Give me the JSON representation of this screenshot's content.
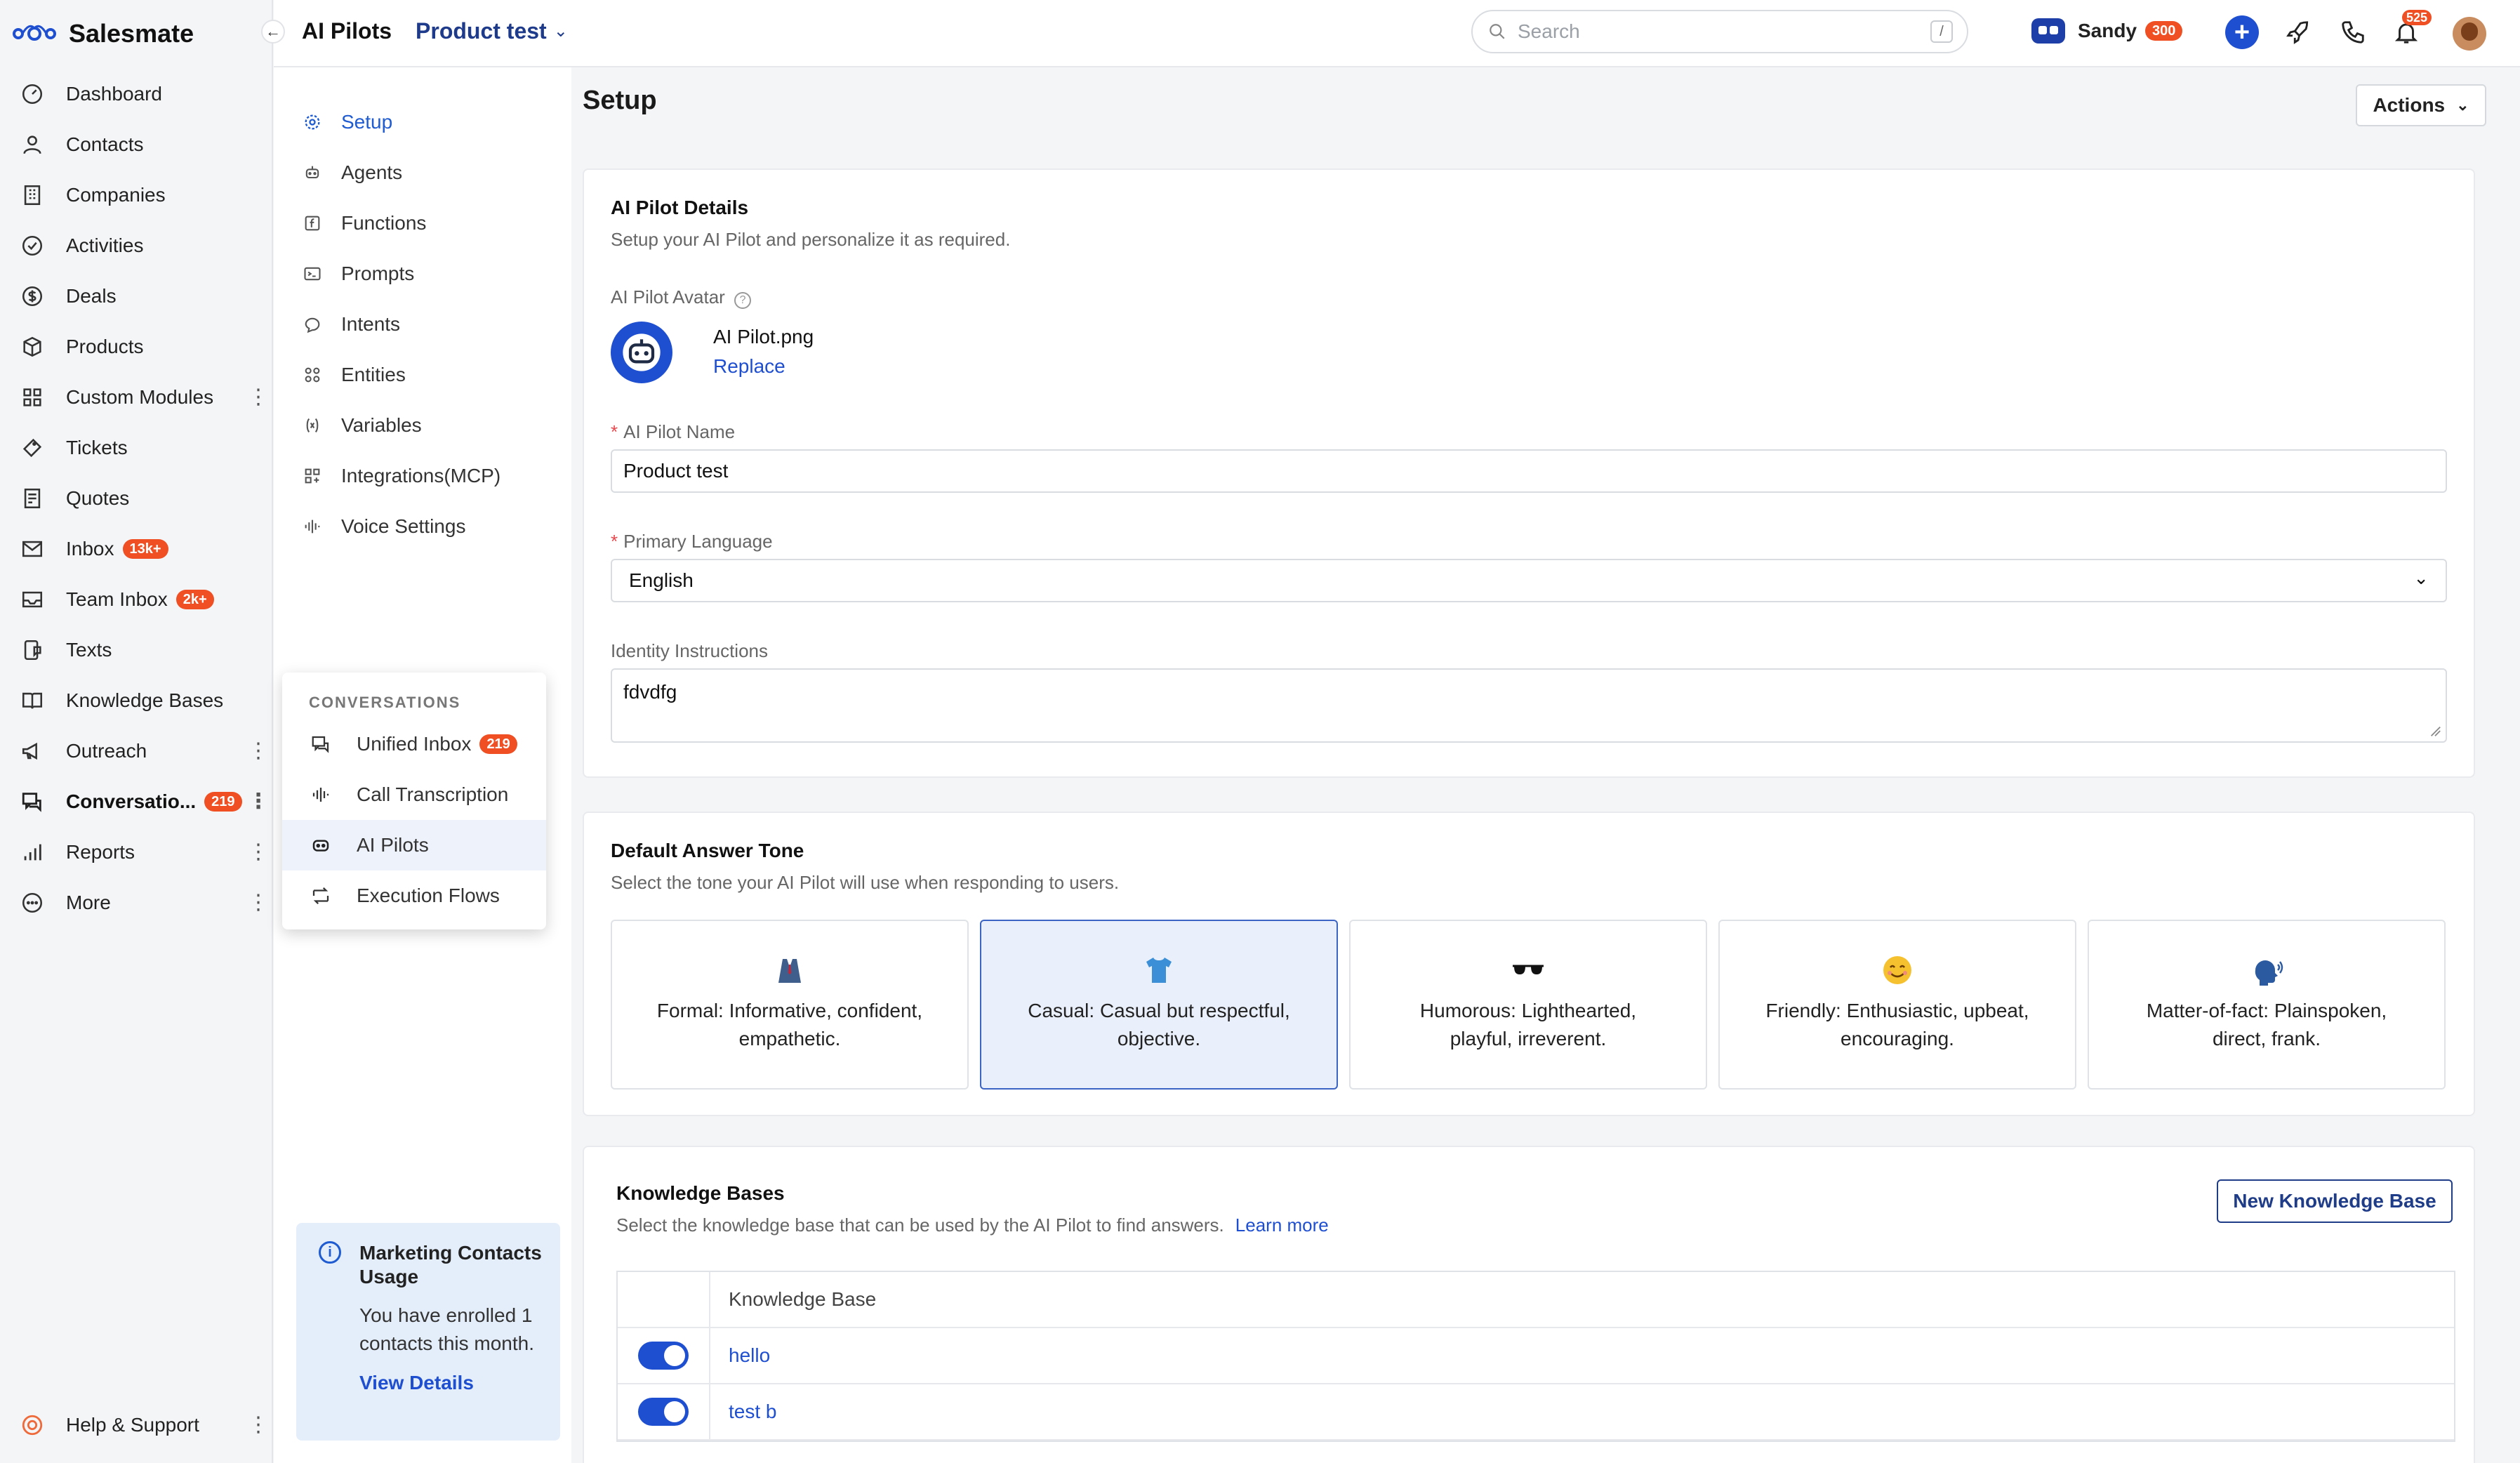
{
  "brand": {
    "name": "Salesmate"
  },
  "nav": {
    "items": [
      {
        "label": "Dashboard",
        "icon": "dashboard-icon"
      },
      {
        "label": "Contacts",
        "icon": "user-icon"
      },
      {
        "label": "Companies",
        "icon": "building-icon"
      },
      {
        "label": "Activities",
        "icon": "check-circle-icon"
      },
      {
        "label": "Deals",
        "icon": "dollar-icon"
      },
      {
        "label": "Products",
        "icon": "box-icon"
      },
      {
        "label": "Custom Modules",
        "icon": "grid-icon"
      },
      {
        "label": "Tickets",
        "icon": "ticket-icon"
      },
      {
        "label": "Quotes",
        "icon": "quote-icon"
      },
      {
        "label": "Inbox",
        "icon": "mail-icon",
        "badge": "13k+"
      },
      {
        "label": "Team Inbox",
        "icon": "inbox-icon",
        "badge": "2k+"
      },
      {
        "label": "Texts",
        "icon": "text-icon"
      },
      {
        "label": "Knowledge Bases",
        "icon": "book-icon"
      },
      {
        "label": "Outreach",
        "icon": "megaphone-icon"
      },
      {
        "label": "Conversatio...",
        "icon": "chat-icon",
        "badge": "219"
      },
      {
        "label": "Reports",
        "icon": "bar-chart-icon"
      },
      {
        "label": "More",
        "icon": "more-icon"
      }
    ],
    "help": {
      "label": "Help & Support"
    }
  },
  "topbar": {
    "breadcrumb_root": "AI Pilots",
    "breadcrumb_current": "Product test",
    "search_placeholder": "Search",
    "search_shortcut": "/",
    "user_name": "Sandy",
    "user_badge": "300",
    "notif_count": "525"
  },
  "subnav": {
    "items": [
      {
        "label": "Setup"
      },
      {
        "label": "Agents"
      },
      {
        "label": "Functions"
      },
      {
        "label": "Prompts"
      },
      {
        "label": "Intents"
      },
      {
        "label": "Entities"
      },
      {
        "label": "Variables"
      },
      {
        "label": "Integrations(MCP)"
      },
      {
        "label": "Voice Settings"
      }
    ],
    "usage": {
      "title": "Marketing Contacts Usage",
      "body": "You have enrolled 1 contacts this month.",
      "link": "View Details"
    }
  },
  "flyout": {
    "header": "CONVERSATIONS",
    "items": [
      {
        "label": "Unified Inbox",
        "badge": "219"
      },
      {
        "label": "Call Transcription"
      },
      {
        "label": "AI Pilots"
      },
      {
        "label": "Execution Flows"
      }
    ]
  },
  "main": {
    "title": "Setup",
    "actions_label": "Actions",
    "details": {
      "title": "AI Pilot Details",
      "desc": "Setup your AI Pilot and personalize it as required.",
      "avatar_label": "AI Pilot Avatar",
      "avatar_file": "AI Pilot.png",
      "replace_label": "Replace",
      "name_label": "AI Pilot Name",
      "name_value": "Product test",
      "lang_label": "Primary Language",
      "lang_value": "English",
      "identity_label": "Identity Instructions",
      "identity_value": "fdvdfg"
    },
    "tone": {
      "title": "Default Answer Tone",
      "desc": "Select the tone your AI Pilot will use when responding to users.",
      "options": [
        {
          "line1": "Formal: Informative, confident,",
          "line2": "empathetic.",
          "emoji": "suit-emoji-icon"
        },
        {
          "line1": "Casual: Casual but respectful,",
          "line2": "objective.",
          "emoji": "tshirt-emoji-icon"
        },
        {
          "line1": "Humorous: Lighthearted,",
          "line2": "playful, irreverent.",
          "emoji": "sunglasses-emoji-icon"
        },
        {
          "line1": "Friendly: Enthusiastic, upbeat,",
          "line2": "encouraging.",
          "emoji": "smile-emoji-icon"
        },
        {
          "line1": "Matter-of-fact: Plainspoken,",
          "line2": "direct, frank.",
          "emoji": "speaking-head-emoji-icon"
        }
      ]
    },
    "kb": {
      "title": "Knowledge Bases",
      "desc": "Select the knowledge base that can be used by the AI Pilot to find answers.",
      "learn_more": "Learn more",
      "new_button": "New Knowledge Base",
      "col_header": "Knowledge Base",
      "rows": [
        {
          "name": "hello"
        },
        {
          "name": "test b"
        }
      ]
    }
  },
  "colors": {
    "accent": "#1f4fd1",
    "badge": "#ef4f23",
    "selected_tone_bg": "#eaf0fb"
  }
}
